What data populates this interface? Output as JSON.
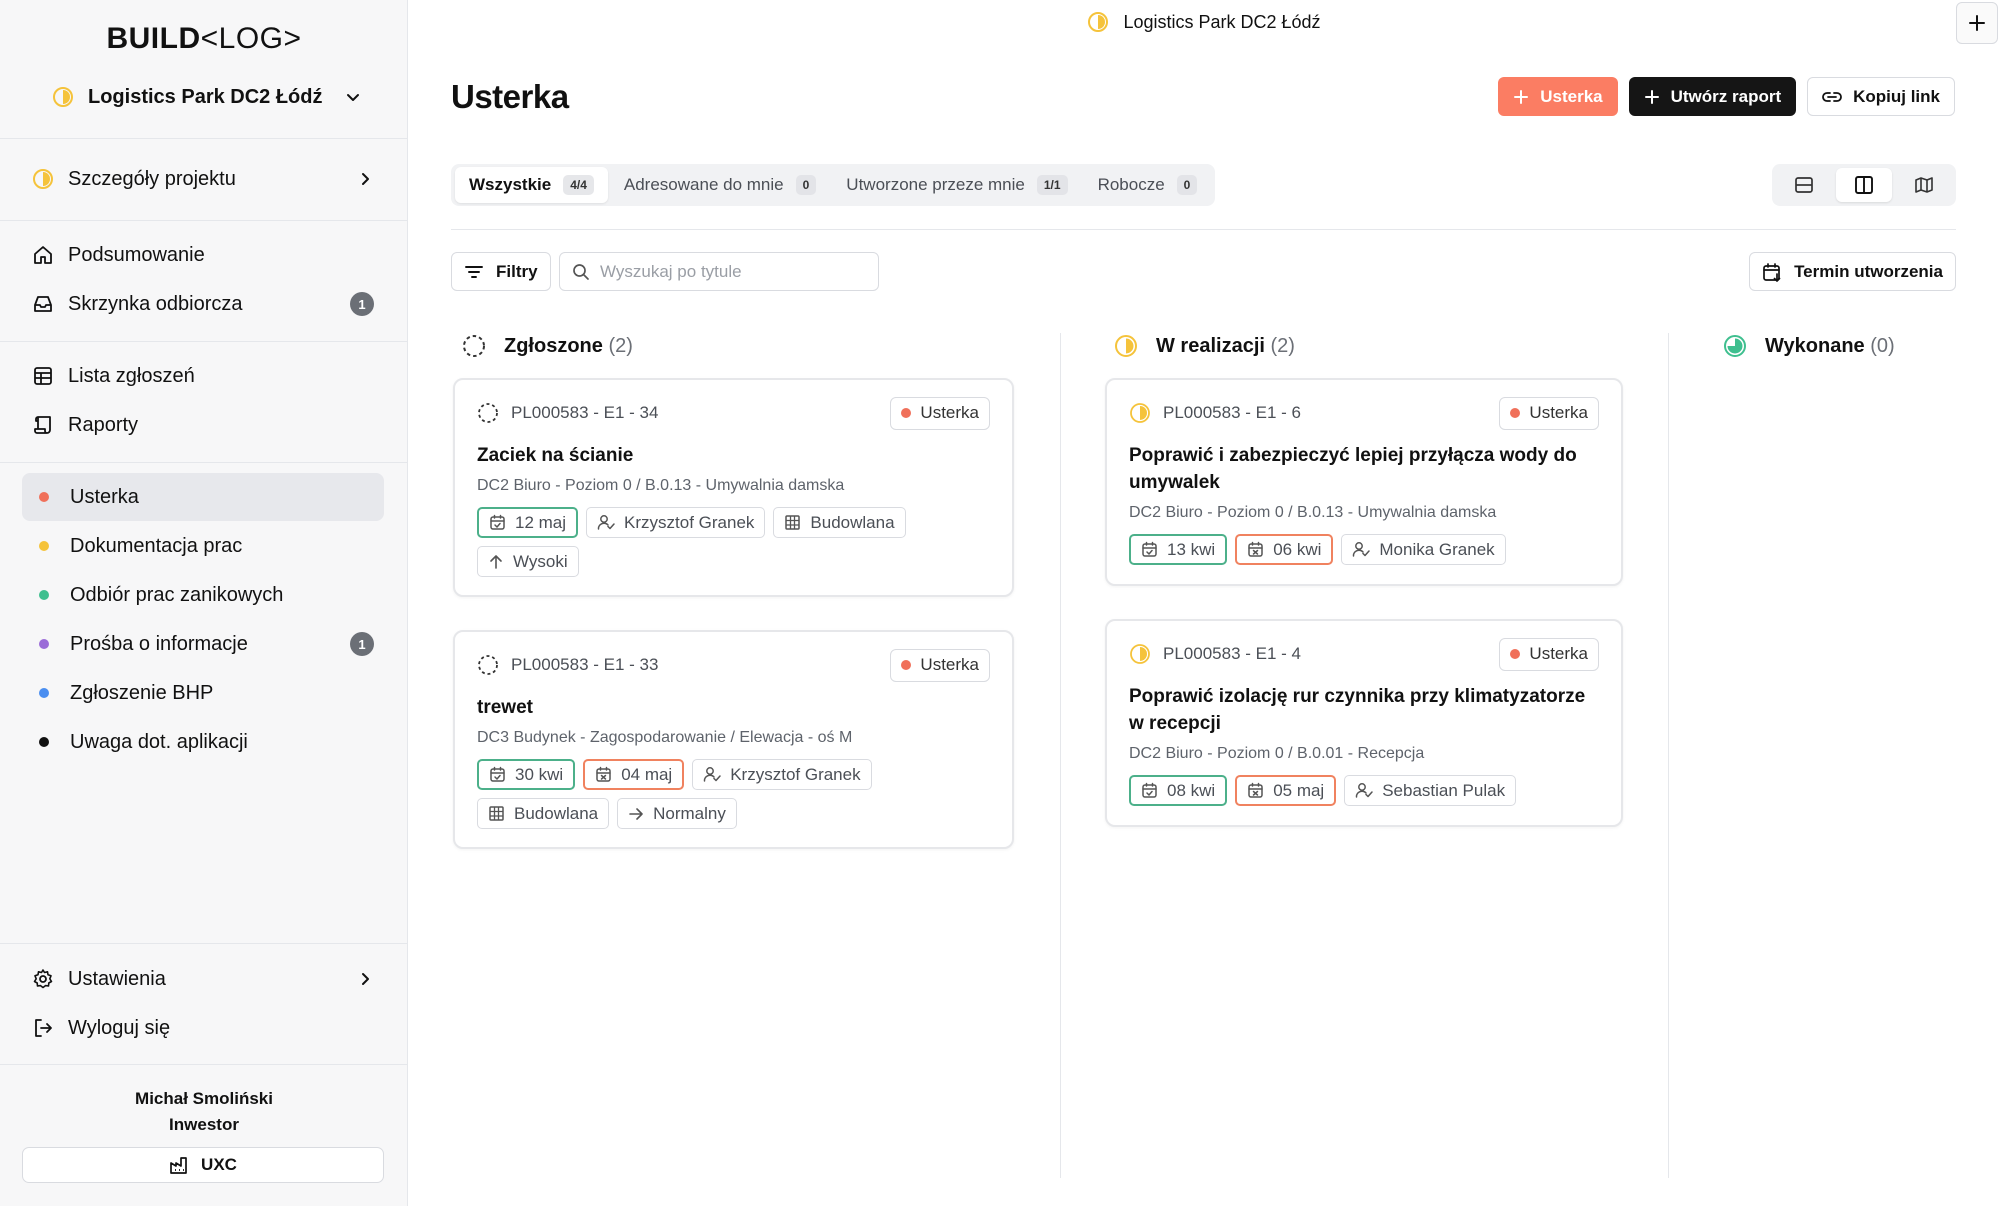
{
  "app": {
    "logo_bold": "BUILD",
    "logo_rest": "<LOG>"
  },
  "colors": {
    "accent_orange": "#fb7d63",
    "status_yellow": "#f5c33b",
    "status_green": "#3fbf8f",
    "dark": "#151515"
  },
  "sidebar": {
    "project_name": "Logistics Park DC2 Łódź",
    "project_details": "Szczegóły projektu",
    "summary": "Podsumowanie",
    "inbox": "Skrzynka odbiorcza",
    "inbox_count": "1",
    "list": "Lista zgłoszeń",
    "reports": "Raporty",
    "categories": [
      {
        "label": "Usterka",
        "color": "#f0705a",
        "badge": ""
      },
      {
        "label": "Dokumentacja prac",
        "color": "#f5c33b",
        "badge": ""
      },
      {
        "label": "Odbiór prac zanikowych",
        "color": "#3fbf8f",
        "badge": ""
      },
      {
        "label": "Prośba o informacje",
        "color": "#9b6cd8",
        "badge": "1"
      },
      {
        "label": "Zgłoszenie BHP",
        "color": "#4a8ef0",
        "badge": ""
      },
      {
        "label": "Uwaga dot. aplikacji",
        "color": "#111111",
        "badge": ""
      }
    ],
    "settings": "Ustawienia",
    "logout": "Wyloguj się",
    "user_name": "Michał Smoliński",
    "user_role": "Inwestor",
    "org_button": "UXC"
  },
  "topbar": {
    "project_name": "Logistics Park DC2 Łódź"
  },
  "header": {
    "title": "Usterka",
    "btn_add": "Usterka",
    "btn_report": "Utwórz raport",
    "btn_copy": "Kopiuj link"
  },
  "tabs": [
    {
      "label": "Wszystkie",
      "count": "4/4"
    },
    {
      "label": "Adresowane do mnie",
      "count": "0"
    },
    {
      "label": "Utworzone przeze mnie",
      "count": "1/1"
    },
    {
      "label": "Robocze",
      "count": "0"
    }
  ],
  "toolbar": {
    "filters": "Filtry",
    "search_placeholder": "Wyszukaj po tytule",
    "sort": "Termin utworzenia"
  },
  "columns": [
    {
      "title": "Zgłoszone",
      "count": "(2)"
    },
    {
      "title": "W realizacji",
      "count": "(2)"
    },
    {
      "title": "Wykonane",
      "count": "(0)"
    }
  ],
  "cards": [
    {
      "id": "PL000583 - E1 - 34",
      "type": "Usterka",
      "title": "Zaciek na ścianie",
      "location": "DC2 Biuro - Poziom 0 / B.0.13 - Umywalnia damska",
      "created": "12 maj",
      "assignee": "Krzysztof Granek",
      "trade": "Budowlana",
      "priority": "Wysoki"
    },
    {
      "id": "PL000583 - E1 - 33",
      "type": "Usterka",
      "title": "trewet",
      "location": "DC3 Budynek - Zagospodarowanie / Elewacja - oś M",
      "created": "30 kwi",
      "due": "04 maj",
      "assignee": "Krzysztof Granek",
      "trade": "Budowlana",
      "priority": "Normalny"
    },
    {
      "id": "PL000583 - E1 - 6",
      "type": "Usterka",
      "title": "Poprawić i zabezpieczyć lepiej przyłącza wody do umywalek",
      "location": "DC2 Biuro - Poziom 0 / B.0.13 - Umywalnia damska",
      "created": "13 kwi",
      "due": "06 kwi",
      "assignee": "Monika Granek"
    },
    {
      "id": "PL000583 - E1 - 4",
      "type": "Usterka",
      "title": "Poprawić izolację rur czynnika przy klimatyzatorze w recepcji",
      "location": "DC2 Biuro - Poziom 0 / B.0.01 - Recepcja",
      "created": "08 kwi",
      "due": "05 maj",
      "assignee": "Sebastian Pulak"
    }
  ]
}
